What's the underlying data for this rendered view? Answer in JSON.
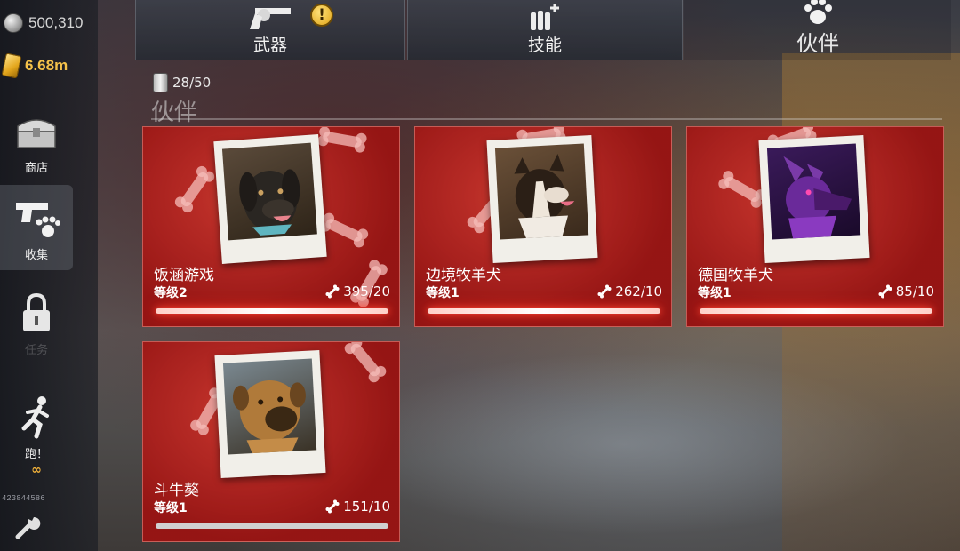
{
  "currencies": {
    "silver": {
      "value": "500,310",
      "icon": "silver-coin-icon"
    },
    "gold": {
      "value": "6.68m",
      "icon": "gold-bar-icon"
    }
  },
  "sidebar": {
    "items": [
      {
        "label": "商店",
        "icon": "chest-icon"
      },
      {
        "label": "收集",
        "icon": "gun-paw-icon",
        "active": true
      },
      {
        "label": "任务",
        "icon": "lock-icon",
        "locked": true
      },
      {
        "label": "跑！",
        "icon": "runner-icon",
        "sub": "∞"
      }
    ],
    "player_id": "423844586"
  },
  "tabs": [
    {
      "label": "武器",
      "icon": "revolver-icon",
      "alert": "!"
    },
    {
      "label": "技能",
      "icon": "ammo-plus-icon"
    },
    {
      "label": "伙伴",
      "icon": "paw-icon",
      "active": true
    }
  ],
  "section": {
    "food_count": "28/50",
    "title": "伙伴"
  },
  "pets": [
    {
      "name": "饭涵游戏",
      "level": "等级2",
      "bones": "395/20",
      "progress": 1.0,
      "glow": true
    },
    {
      "name": "边境牧羊犬",
      "level": "等级1",
      "bones": "262/10",
      "progress": 1.0,
      "glow": true
    },
    {
      "name": "德国牧羊犬",
      "level": "等级1",
      "bones": "85/10",
      "progress": 1.0,
      "glow": true
    },
    {
      "name": "斗牛獒",
      "level": "等级1",
      "bones": "151/10",
      "progress": 1.0,
      "glow": false
    }
  ],
  "colors": {
    "accent_gold": "#f5c24a",
    "card_red": "#b3241c",
    "progress_glow": "#ff4a3a"
  }
}
